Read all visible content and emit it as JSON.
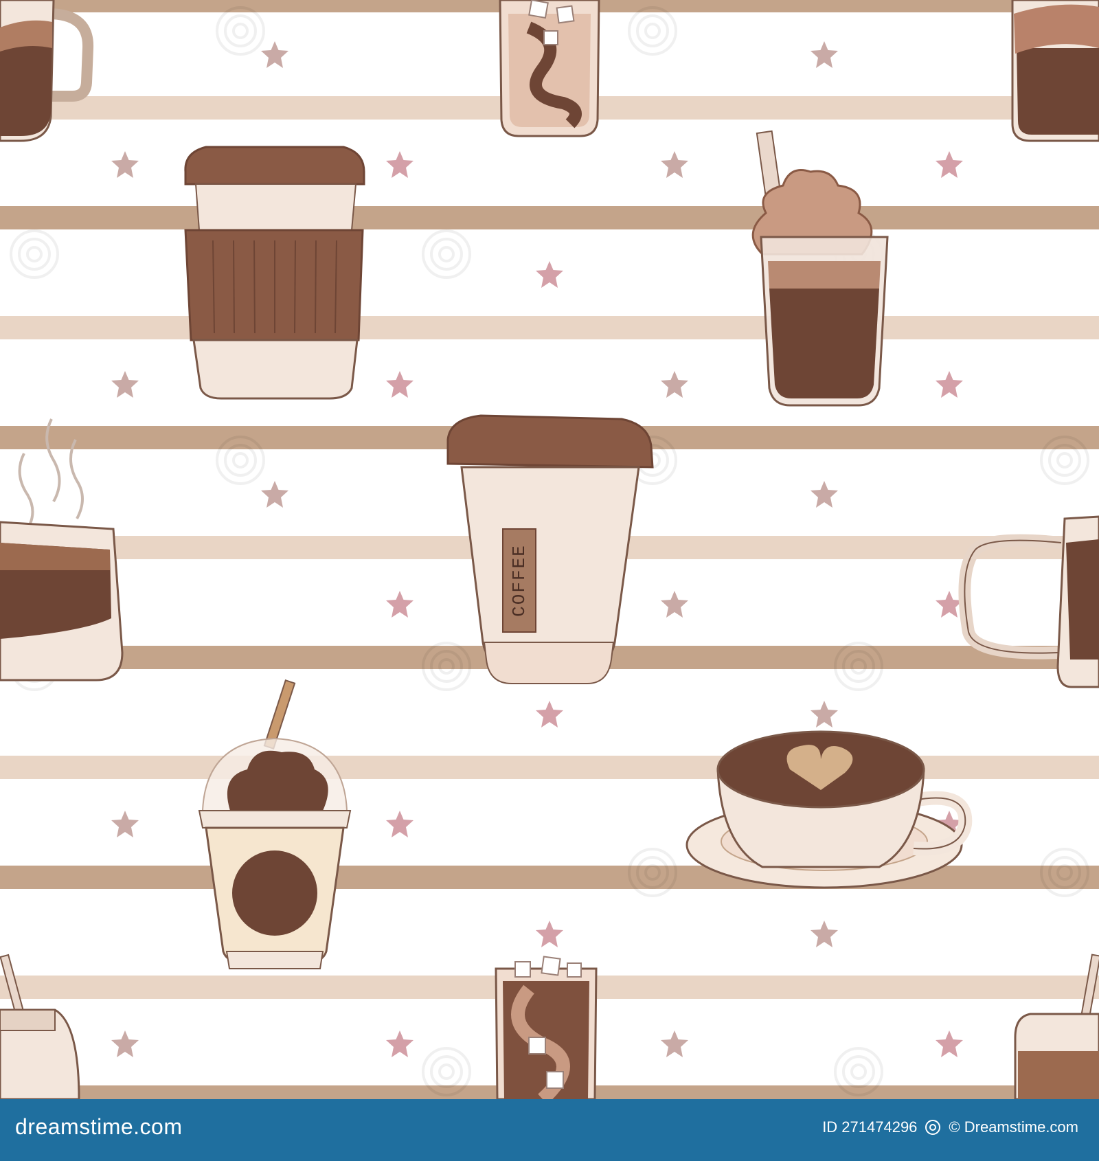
{
  "illustration": {
    "cup_label": "COFFEE",
    "stripe_light": "#e9d5c5",
    "stripe_dark": "#c4a48a",
    "coffee_dark": "#6e4535",
    "coffee_mid": "#8a5a45",
    "cream": "#f5e8dd",
    "star_pink": "#d4a0a8",
    "star_mauve": "#c9aaa6",
    "outline": "#7a5848",
    "watermark": "dreamstime"
  },
  "footer": {
    "site": "dreamstime.com",
    "image_id": "ID 271474296",
    "copyright": "© Dreamstime.com",
    "background": "#1f6f9f"
  }
}
